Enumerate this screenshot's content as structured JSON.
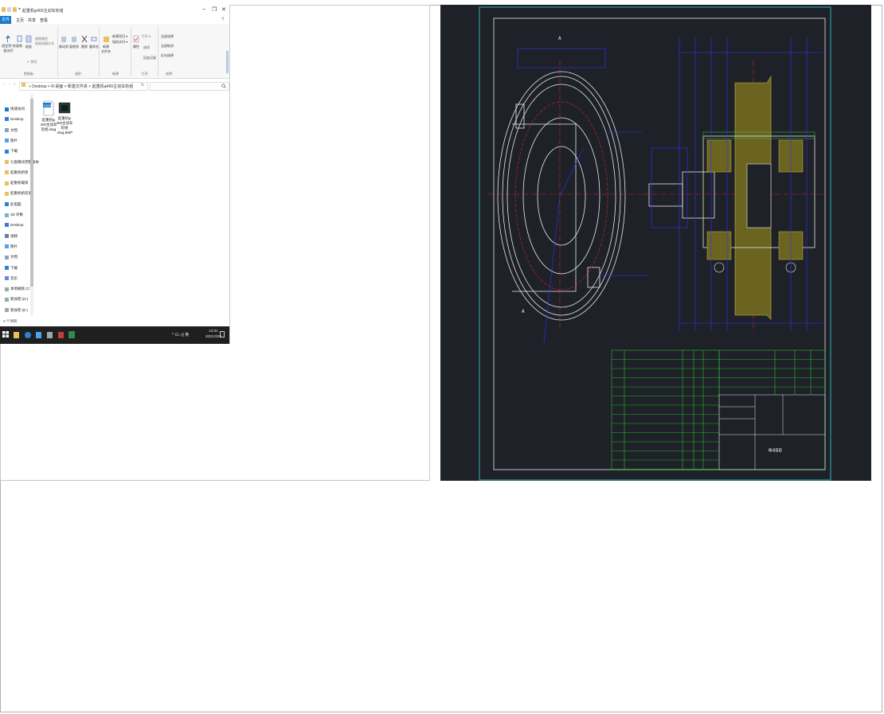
{
  "explorer": {
    "window_title": "起重机φ400主动车轮组",
    "window_controls": {
      "minimize": "–",
      "maximize": "❐",
      "close": "✕"
    },
    "tabs": {
      "file": "文件",
      "home": "主页",
      "share": "共享",
      "view": "查看"
    },
    "ribbon": {
      "pin_label": "固定到\"快速访问\"",
      "copy_label": "复制",
      "paste_label": "粘贴",
      "cut_label": "✂ 剪切",
      "copy_path_label": "复制路径",
      "paste_shortcut_label": "粘贴快捷方式",
      "move_to_label": "移动到",
      "copy_to_label": "复制到",
      "delete_label": "删除",
      "rename_label": "重命名",
      "new_folder_label": "新建\n文件夹",
      "new_item_label": "新建项目 ▾",
      "easy_access_label": "轻松访问 ▾",
      "properties_label": "属性",
      "open_label": "打开 ▾",
      "edit_label": "编辑",
      "history_label": "历史记录",
      "select_all_label": "全部选择",
      "select_none_label": "全部取消",
      "invert_label": "反向选择",
      "groups": {
        "clipboard": "剪贴板",
        "organize": "组织",
        "new": "新建",
        "open": "打开",
        "select": "选择"
      }
    },
    "address": {
      "path": "«  Desktop  >  R:桌面  >  新建文件夹  >  起重机φ400主动车轮组",
      "refresh_icon": "↻"
    },
    "sidebar": {
      "items": [
        {
          "label": "快速访问",
          "icon": "star-icon"
        },
        {
          "label": "Desktop",
          "icon": "desktop-icon"
        },
        {
          "label": "文档",
          "icon": "document-icon"
        },
        {
          "label": "图片",
          "icon": "picture-icon"
        },
        {
          "label": "下载",
          "icon": "download-icon"
        },
        {
          "label": "七套模块完整版本",
          "icon": "folder-icon"
        },
        {
          "label": "起重机桥架",
          "icon": "folder-icon"
        },
        {
          "label": "起重机端梁",
          "icon": "folder-icon"
        },
        {
          "label": "起重机桥双梁",
          "icon": "folder-icon"
        },
        {
          "label": "此电脑",
          "icon": "computer-icon"
        },
        {
          "label": "3D 对象",
          "icon": "cube-icon"
        },
        {
          "label": "Desktop",
          "icon": "desktop-icon"
        },
        {
          "label": "视频",
          "icon": "video-icon"
        },
        {
          "label": "图片",
          "icon": "picture-icon"
        },
        {
          "label": "文档",
          "icon": "document-icon"
        },
        {
          "label": "下载",
          "icon": "download-icon"
        },
        {
          "label": "音乐",
          "icon": "music-icon"
        },
        {
          "label": "本地磁盘 (C:)",
          "icon": "drive-icon"
        },
        {
          "label": "新加卷 (D:)",
          "icon": "drive-icon"
        },
        {
          "label": "新加卷 (E:)",
          "icon": "drive-icon"
        }
      ]
    },
    "files": [
      {
        "name": "起重机φ400主动车轮组.dwg",
        "lines": [
          "起重机φ",
          "400主动车",
          "轮组.dwg"
        ],
        "icon": "dwg-file-icon"
      },
      {
        "name": "起重机φ400主动车轮组.dwg.BMP",
        "lines": [
          "起重机φ",
          "400主动车",
          "轮组",
          ".dwg.BMP"
        ],
        "icon": "bmp-file-icon"
      }
    ],
    "status": "2 个项目"
  },
  "taskbar": {
    "time": "13:31",
    "date": "2021/3/29",
    "tray": "^ ⊡ ◁) 英"
  },
  "drawing": {
    "title_block_text": "Φ400",
    "section_marker": "A",
    "colors": {
      "background": "#1e2228",
      "frame": "#2fb3b3",
      "lines": "#e8e8e8",
      "dimension": "#3030ff",
      "center": "#e02020",
      "hatch": "#9a8a2a",
      "table": "#2fd12f"
    }
  }
}
